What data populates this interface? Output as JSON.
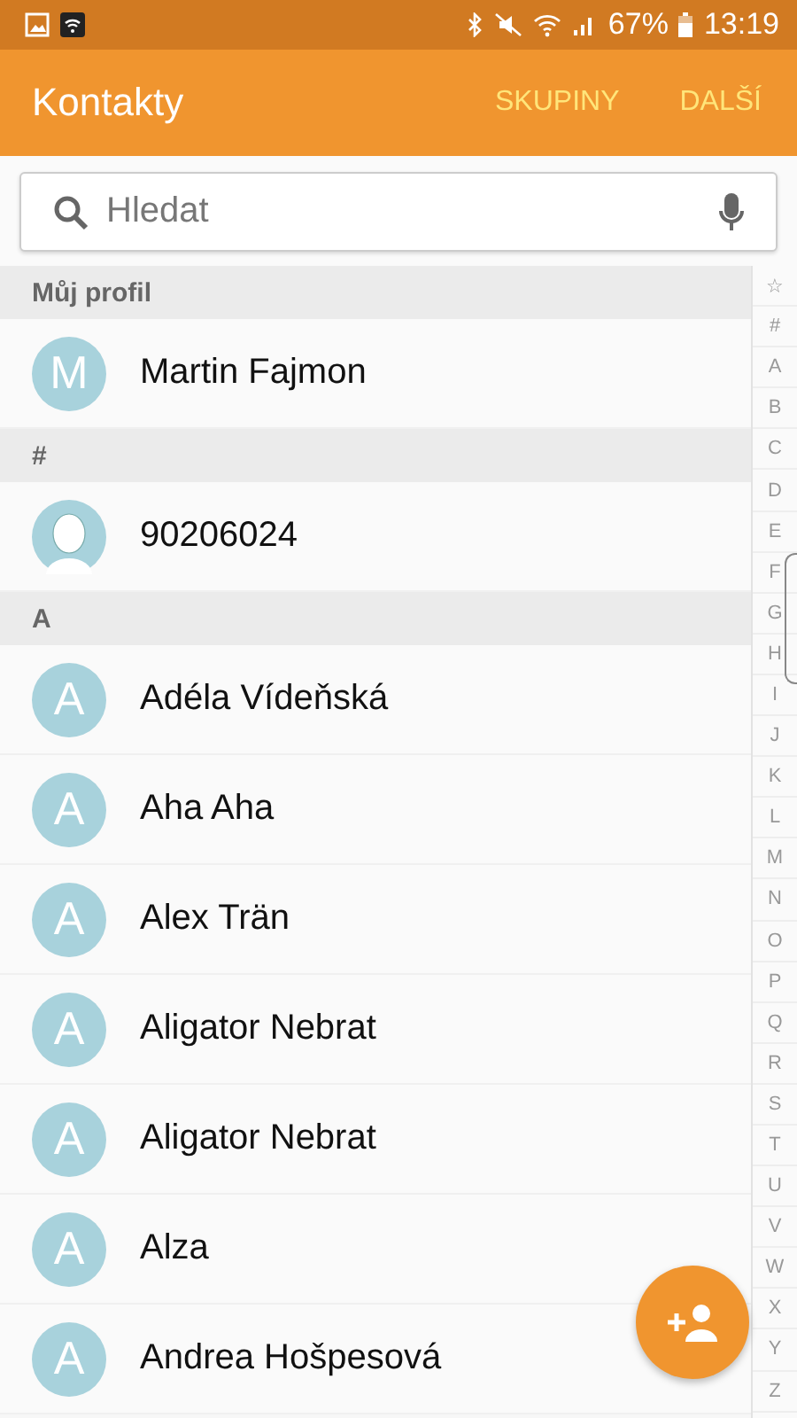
{
  "status_bar": {
    "battery": "67%",
    "time": "13:19"
  },
  "app_bar": {
    "title": "Kontakty",
    "actions": [
      "SKUPINY",
      "DALŠÍ"
    ]
  },
  "search": {
    "placeholder": "Hledat"
  },
  "sections": [
    {
      "header": "Můj profil",
      "contacts": [
        {
          "name": "Martin Fajmon",
          "kind": "letter",
          "initial": "M"
        }
      ]
    },
    {
      "header": "#",
      "contacts": [
        {
          "name": "90206024",
          "kind": "photo"
        }
      ]
    },
    {
      "header": "A",
      "contacts": [
        {
          "name": "Adéla Vídeňská",
          "kind": "letter",
          "initial": "A"
        },
        {
          "name": "Aha Aha",
          "kind": "letter",
          "initial": "A"
        },
        {
          "name": "Alex Trän",
          "kind": "letter",
          "initial": "A"
        },
        {
          "name": "Aligator Nebrat",
          "kind": "letter",
          "initial": "A"
        },
        {
          "name": "Aligator Nebrat",
          "kind": "letter",
          "initial": "A"
        },
        {
          "name": "Alza",
          "kind": "letter",
          "initial": "A"
        },
        {
          "name": "Andrea Hošpesová",
          "kind": "letter",
          "initial": "A"
        }
      ]
    }
  ],
  "index": [
    "☆",
    "#",
    "A",
    "B",
    "C",
    "D",
    "E",
    "F",
    "G",
    "H",
    "I",
    "J",
    "K",
    "L",
    "M",
    "N",
    "O",
    "P",
    "Q",
    "R",
    "S",
    "T",
    "U",
    "V",
    "W",
    "X",
    "Y",
    "Z"
  ]
}
